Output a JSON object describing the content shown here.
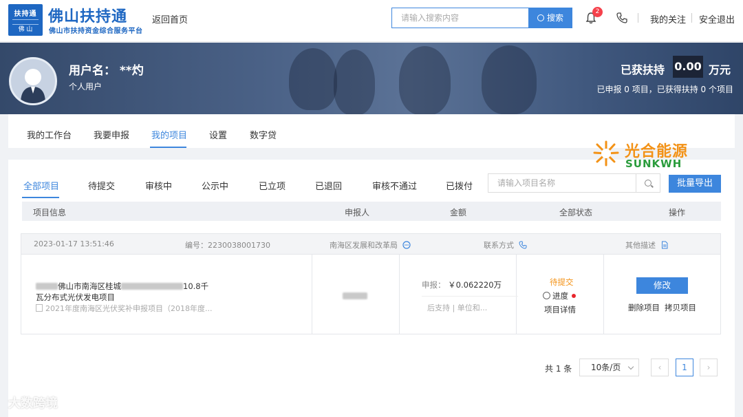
{
  "header": {
    "logo_badge_top": "扶持通",
    "logo_badge_bottom": "佛 山",
    "logo_title": "佛山扶持通",
    "logo_subtitle": "佛山市扶持资金综合服务平台",
    "back_home": "返回首页",
    "search_placeholder": "请输入搜索内容",
    "search_button": "搜索",
    "notification_count": "2",
    "my_follow": "我的关注",
    "logout": "安全退出"
  },
  "banner": {
    "user_name": "用户名： **灼",
    "user_type": "个人用户",
    "support_label": "已获扶持",
    "support_value": "0.00",
    "support_unit": "万元",
    "summary": "已申报 0 项目，已获得扶持 0 个项目"
  },
  "nav": {
    "items": [
      "我的工作台",
      "我要申报",
      "我的项目",
      "设置",
      "数字贷"
    ],
    "active": "我的项目"
  },
  "brand_watermark": {
    "cn": "光合能源",
    "en": "SUNKWH"
  },
  "filters": {
    "tabs": [
      "全部项目",
      "待提交",
      "审核中",
      "公示中",
      "已立项",
      "已退回",
      "审核不通过",
      "已拨付"
    ],
    "active": "全部项目",
    "name_placeholder": "请输入项目名称",
    "export_button": "批量导出"
  },
  "table": {
    "headers": [
      "项目信息",
      "申报人",
      "金额",
      "全部状态",
      "操作"
    ]
  },
  "project": {
    "date": "2023-01-17 13:51:46",
    "number": "编号：2230038001730",
    "department": "南海区发展和改革局",
    "contact": "联系方式",
    "other_desc": "其他描述",
    "title_part1": "佛山市南海区桂城",
    "title_part2": "10.8千",
    "title_line2": "瓦分布式光伏发电项目",
    "subtitle": "2021年度南海区光伏奖补申报项目（2018年度...",
    "amount_label": "申报：",
    "amount_value": "￥0.062220万",
    "support_text": "后支持 | 单位和...",
    "status": "待提交",
    "progress": "进度",
    "detail": "项目详情",
    "edit_button": "修改",
    "delete": "删除项目",
    "copy": "拷贝项目"
  },
  "pagination": {
    "total": "共 1 条",
    "page_size": "10条/页",
    "prev": "‹",
    "current": "1",
    "next": "›"
  },
  "corner_watermark": "大数跨境",
  "colors": {
    "primary": "#3d86dd",
    "status_pending": "#f39216",
    "banner": "#4a6186"
  }
}
